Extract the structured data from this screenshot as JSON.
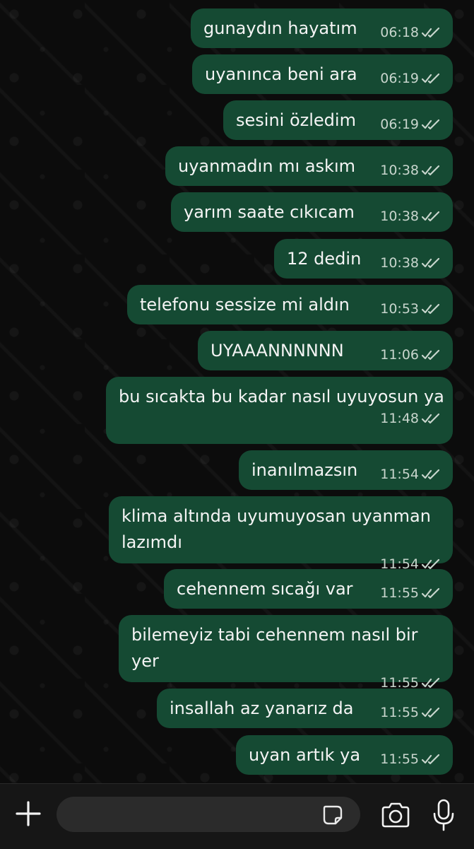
{
  "chat": {
    "messages": [
      {
        "text": "gunaydın hayatım",
        "time": "06:18"
      },
      {
        "text": "uyanınca beni ara",
        "time": "06:19"
      },
      {
        "text": "sesini özledim",
        "time": "06:19"
      },
      {
        "text": "uyanmadın mı askım",
        "time": "10:38"
      },
      {
        "text": "yarım saate cıkıcam",
        "time": "10:38"
      },
      {
        "text": "12 dedin",
        "time": "10:38"
      },
      {
        "text": "telefonu sessize mi aldın",
        "time": "10:53"
      },
      {
        "text": "UYAAANNNNNN",
        "time": "11:06"
      },
      {
        "text": "bu sıcakta bu kadar nasıl uyuyosun ya",
        "time": "11:48"
      },
      {
        "text": "inanılmazsın",
        "time": "11:54"
      },
      {
        "text": "klima altında uyumuyosan uyanman lazımdı",
        "time": "11:54"
      },
      {
        "text": "cehennem sıcağı var",
        "time": "11:55"
      },
      {
        "text": "bilemeyiz tabi cehennem nasıl bir yer",
        "time": "11:55"
      },
      {
        "text": "insallah az yanarız da",
        "time": "11:55"
      },
      {
        "text": "uyan artık ya",
        "time": "11:55"
      }
    ]
  },
  "composer": {
    "input_value": "",
    "icons": [
      "plus-icon",
      "sticker-icon",
      "camera-icon",
      "microphone-icon"
    ]
  },
  "colors": {
    "outgoing_bubble": "#154a33",
    "background": "#0c0c0c",
    "read_ticks": "#c8d5cd"
  }
}
